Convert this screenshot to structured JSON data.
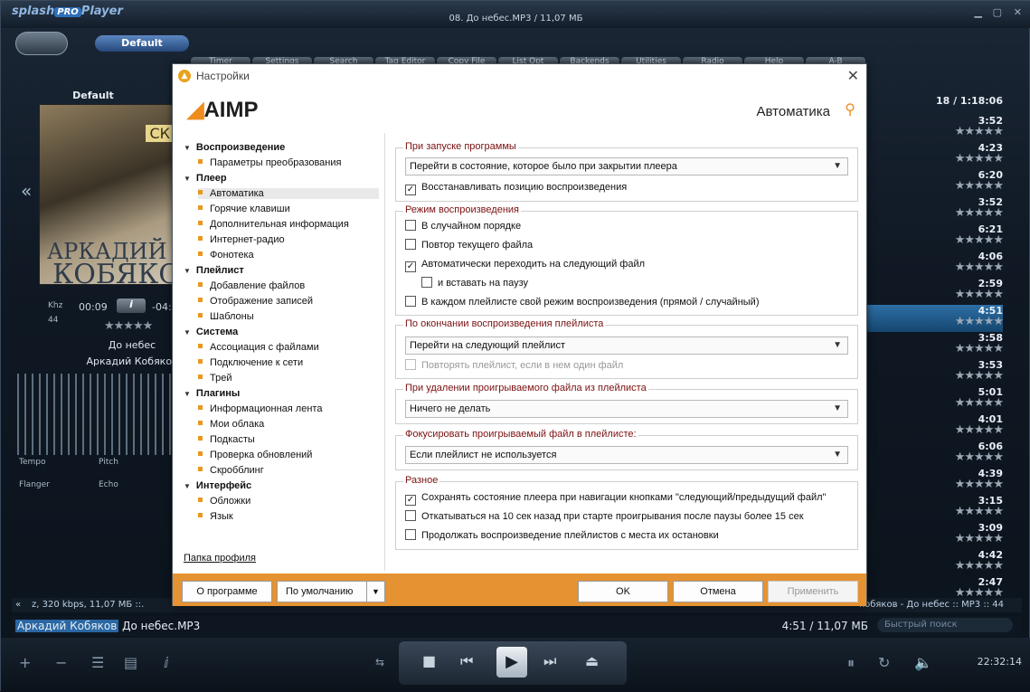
{
  "player": {
    "logo": "splash",
    "logo_badge": "PRO",
    "logo_suffix": "Player",
    "window_title": "08. До небес.MP3 / 11,07 МБ",
    "preset": "Default",
    "tabs": [
      "Timer",
      "Settings",
      "Search",
      "Tag Editor",
      "Copy File",
      "List Opt",
      "Backends",
      "Utilities",
      "Radio",
      "Help",
      "A-B"
    ],
    "deflabel": "Default",
    "cover_title_1": "АРКАДИЙ",
    "cover_title_2": "КОБЯКОВ",
    "cover_sk": "СК",
    "khz": "Khz",
    "khz_val": "44",
    "time_elapsed": "00:09",
    "info_button": "i",
    "time_remaining": "-04:",
    "rating": "★★★★★",
    "song": "До небес",
    "artist": "Аркадий Кобяков",
    "eq_labels": {
      "tempo": "Tempo",
      "pitch": "Pitch",
      "flanger": "Flanger",
      "echo": "Echo"
    },
    "playlist_header": "18 / 1:18:06",
    "playlist": [
      {
        "time": "3:52",
        "stars": "★★★★★"
      },
      {
        "time": "4:23",
        "stars": "★★★★★"
      },
      {
        "time": "6:20",
        "stars": "★★★★★"
      },
      {
        "time": "3:52",
        "stars": "★★★★★"
      },
      {
        "time": "6:21",
        "stars": "★★★★★"
      },
      {
        "time": "4:06",
        "stars": "★★★★★"
      },
      {
        "time": "2:59",
        "stars": "★★★★★"
      },
      {
        "time": "4:51",
        "stars": "★★★★★",
        "selected": true
      },
      {
        "time": "3:58",
        "stars": "★★★★★"
      },
      {
        "time": "3:53",
        "stars": "★★★★★"
      },
      {
        "time": "5:01",
        "stars": "★★★★★"
      },
      {
        "time": "4:01",
        "stars": "★★★★★"
      },
      {
        "time": "6:06",
        "stars": "★★★★★"
      },
      {
        "time": "4:39",
        "stars": "★★★★★"
      },
      {
        "time": "3:15",
        "stars": "★★★★★"
      },
      {
        "time": "3:09",
        "stars": "★★★★★"
      },
      {
        "time": "4:42",
        "stars": "★★★★★"
      },
      {
        "time": "2:47",
        "stars": "★★★★★"
      }
    ],
    "infobar_left": "z, 320 kbps, 11,07 МБ ::.",
    "infobar_right": "кобяков - До небес :: MP3 :: 44",
    "current_artist": "Аркадий Кобяков",
    "current_file": "До небес.MP3",
    "current_time": "4:51 / 11,07 МБ",
    "quick_search": "Быстрый поиск",
    "clock": "22:32:14"
  },
  "dialog": {
    "title": "Настройки",
    "logo": "AIMP",
    "section_title": "Автоматика",
    "tree": [
      {
        "label": "Воспроизведение",
        "children": [
          "Параметры преобразования"
        ]
      },
      {
        "label": "Плеер",
        "children": [
          "Автоматика",
          "Горячие клавиши",
          "Дополнительная информация",
          "Интернет-радио",
          "Фонотека"
        ]
      },
      {
        "label": "Плейлист",
        "children": [
          "Добавление файлов",
          "Отображение записей",
          "Шаблоны"
        ]
      },
      {
        "label": "Система",
        "children": [
          "Ассоциация с файлами",
          "Подключение к сети",
          "Трей"
        ]
      },
      {
        "label": "Плагины",
        "children": [
          "Информационная лента",
          "Мои облака",
          "Подкасты",
          "Проверка обновлений",
          "Скробблинг"
        ]
      },
      {
        "label": "Интерфейс",
        "children": [
          "Обложки",
          "Язык"
        ]
      }
    ],
    "selected_item": "Автоматика",
    "profile_link": "Папка профиля",
    "groups": {
      "startup": {
        "legend": "При запуске программы",
        "combo": "Перейти в состояние, которое было при закрытии плеера",
        "restore_position": {
          "label": "Восстанавливать позицию воспроизведения",
          "checked": true
        }
      },
      "playmode": {
        "legend": "Режим воспроизведения",
        "shuffle": {
          "label": "В случайном порядке",
          "checked": false
        },
        "repeat_file": {
          "label": "Повтор текущего файла",
          "checked": false
        },
        "auto_next": {
          "label": "Автоматически переходить на следующий файл",
          "checked": true
        },
        "pause": {
          "label": "и вставать на паузу",
          "checked": false
        },
        "per_playlist": {
          "label": "В каждом плейлисте свой режим воспроизведения (прямой / случайный)",
          "checked": false
        }
      },
      "playlist_end": {
        "legend": "По окончании воспроизведения плейлиста",
        "combo": "Перейти на следующий плейлист",
        "repeat_single": {
          "label": "Повторять плейлист, если в нем один файл",
          "checked": false,
          "disabled": true
        }
      },
      "on_delete": {
        "legend": "При удалении проигрываемого файла из плейлиста",
        "combo": "Ничего не делать"
      },
      "focus": {
        "legend": "Фокусировать проигрываемый файл в плейлисте:",
        "combo": "Если плейлист не используется"
      },
      "misc": {
        "legend": "Разное",
        "save_state": {
          "label": "Сохранять состояние плеера при навигации кнопками \"следующий/предыдущий файл\"",
          "checked": true
        },
        "rewind": {
          "label": "Откатываться на 10 сек назад при старте проигрывания после паузы более 15 сек",
          "checked": false
        },
        "resume": {
          "label": "Продолжать воспроизведение плейлистов с места их остановки",
          "checked": false
        }
      }
    },
    "buttons": {
      "about": "О программе",
      "defaults": "По умолчанию",
      "ok": "OK",
      "cancel": "Отмена",
      "apply": "Применить"
    },
    "colors": {
      "accent": "#e59232",
      "legend": "#7a1010"
    }
  }
}
